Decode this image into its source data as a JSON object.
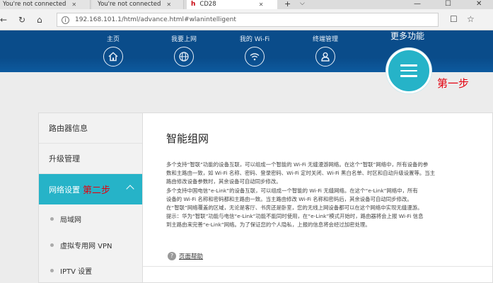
{
  "browser": {
    "tabs": [
      {
        "label": "You're not connected"
      },
      {
        "label": "You're not connected"
      },
      {
        "label": "CD28",
        "logo": "h"
      }
    ],
    "new_tab": "+",
    "tab_menu": "⌵",
    "window": {
      "minimize": "—",
      "maximize": "☐",
      "close": "✕"
    },
    "nav": {
      "back": "←",
      "forward": "→",
      "refresh": "↻",
      "home": "⌂"
    },
    "url": "192.168.101.1/html/advance.html#wlanintelligent",
    "toolbar": {
      "reading": "☐",
      "favorite": "☆"
    }
  },
  "header": {
    "nav": [
      {
        "label": "主页",
        "icon": "home-icon"
      },
      {
        "label": "我要上网",
        "icon": "globe-icon"
      },
      {
        "label": "我的 Wi-Fi",
        "icon": "wifi-icon"
      },
      {
        "label": "终端管理",
        "icon": "user-icon"
      }
    ],
    "more_label": "更多功能",
    "step1": "第一步",
    "colors": {
      "header_bg": "#0a4c8a",
      "accent": "#26b3c8",
      "annotation": "#e3000e"
    }
  },
  "sidebar": {
    "items": [
      {
        "label": "路由器信息"
      },
      {
        "label": "升级管理"
      },
      {
        "label": "网络设置",
        "annotation": "第二步",
        "active": true
      }
    ],
    "sub_items": [
      {
        "label": "局域网"
      },
      {
        "label": "虚拟专用网 VPN"
      },
      {
        "label": "IPTV 设置"
      }
    ]
  },
  "content": {
    "title": "智能组网",
    "paragraphs": [
      "多个支持“智联”功能的设备互联，可以组成一个智能的 Wi-Fi 无缝漫游网络。在这个“智联”网络中，所有设备的参",
      "数和主路由一致，如 Wi-Fi 名称、密码、登录密码、Wi-Fi 定时关闭、Wi-Fi 黑白名单、时区和自动升级设置等。当主",
      "路由修改设备参数时，其余设备可自动同步修改。",
      "多个支持中国电信“e-Link”的设备互联，可以组成一个智能的 Wi-Fi 无缝网络。在这个“e-Link”网络中，所有",
      "设备的 Wi-Fi 名称和密码都和主路由一致。当主路由修改 Wi-Fi 名称和密码后，其余设备可自动同步修改。",
      "在“智联”网络覆盖的区域，无论是客厅、书房还是卧室，您的无线上网设备都可以在这个网络中实现无缝漫游。",
      "提示：华为“智联”功能与电信“e-Link”功能不能同时使用，在“e-Link”模式开始时，路由器将会上报 Wi-Fi 信息",
      "到主路由来完善“e-Link”网络。为了保证您的个人隐私，上报的信息将会经过加密处理。"
    ],
    "help_label": "页面帮助"
  }
}
